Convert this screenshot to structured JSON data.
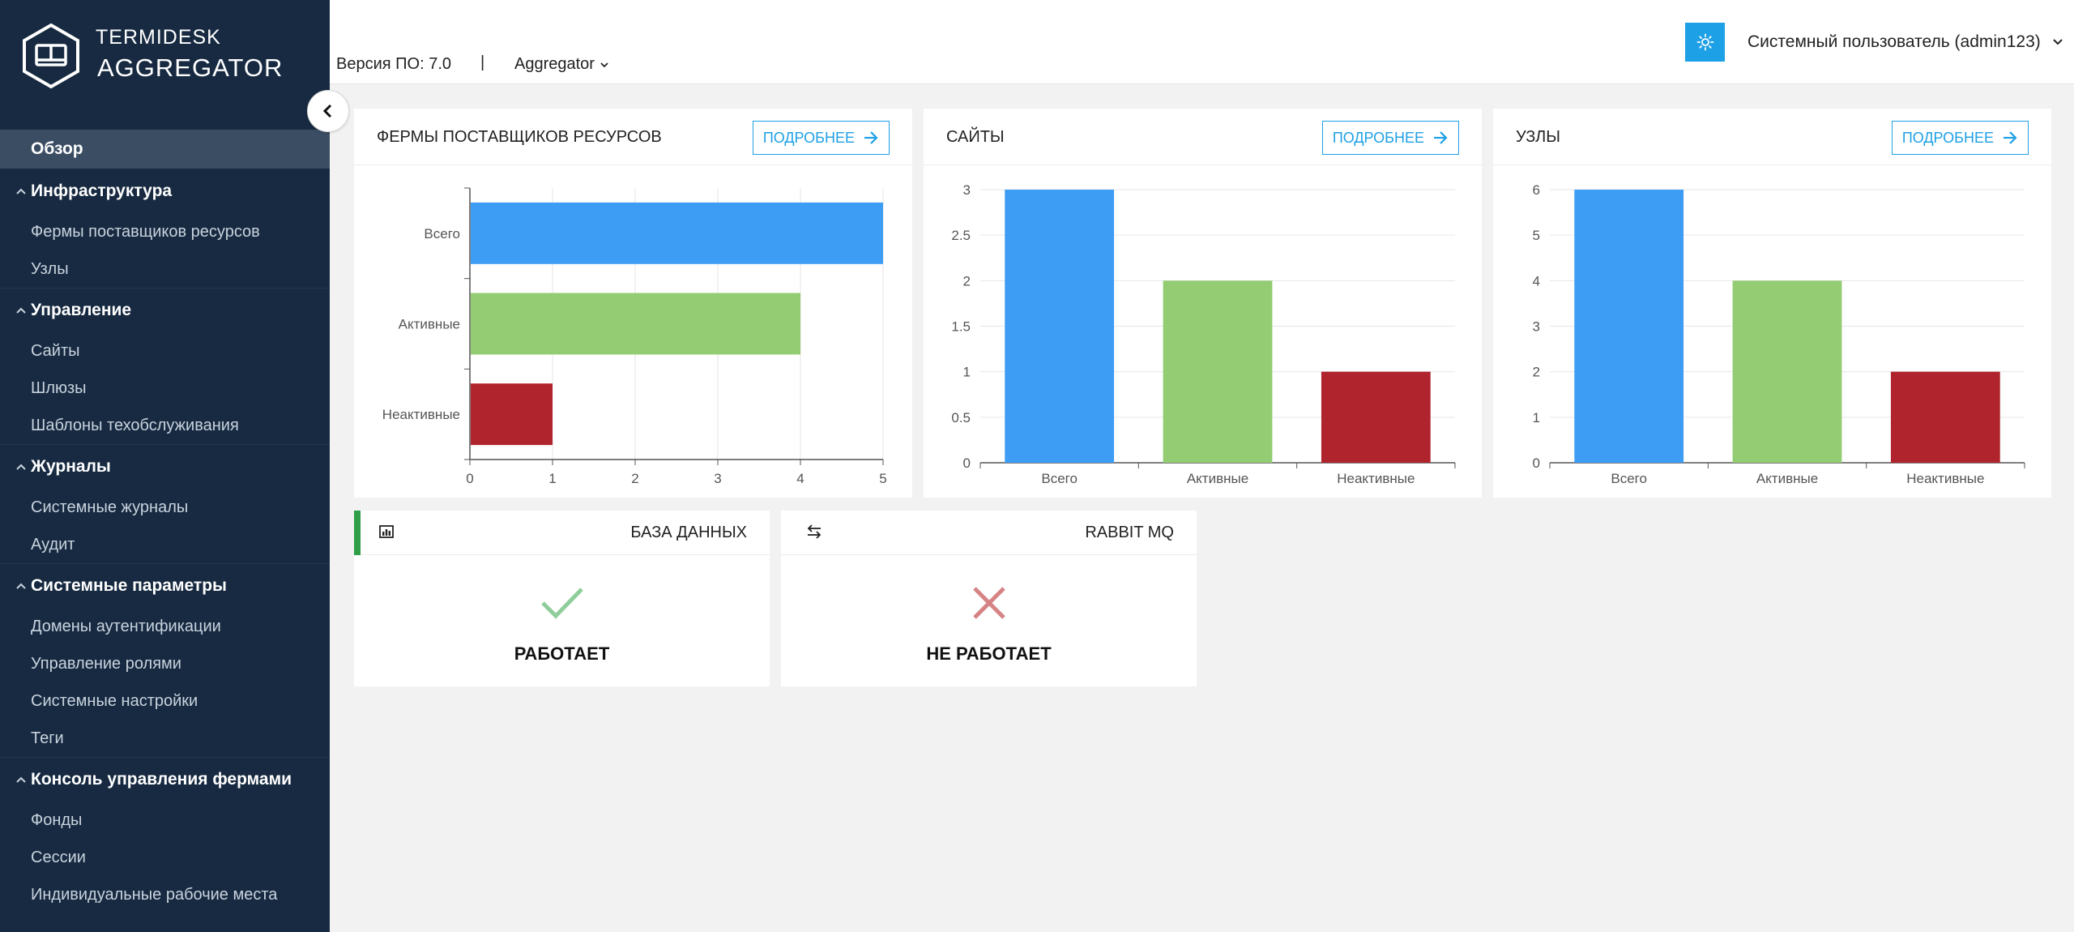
{
  "logo": {
    "top": "TERMIDESK",
    "bottom": "AGGREGATOR"
  },
  "sidebar": {
    "active": "Обзор",
    "groups": [
      {
        "label": "Инфраструктура",
        "items": [
          "Фермы поставщиков ресурсов",
          "Узлы"
        ]
      },
      {
        "label": "Управление",
        "items": [
          "Сайты",
          "Шлюзы",
          "Шаблоны техобслуживания"
        ]
      },
      {
        "label": "Журналы",
        "items": [
          "Системные журналы",
          "Аудит"
        ]
      },
      {
        "label": "Системные параметры",
        "items": [
          "Домены аутентификации",
          "Управление ролями",
          "Системные настройки",
          "Теги"
        ]
      },
      {
        "label": "Консоль управления фермами",
        "items": [
          "Фонды",
          "Сессии",
          "Индивидуальные рабочие места"
        ]
      }
    ]
  },
  "header": {
    "version": "Версия ПО: 7.0",
    "separator": "|",
    "aggregator_menu": "Aggregator",
    "user": "Системный пользователь (admin123)"
  },
  "cards": {
    "farms": {
      "title": "ФЕРМЫ ПОСТАВЩИКОВ РЕСУРСОВ",
      "more": "ПОДРОБНЕЕ"
    },
    "sites": {
      "title": "САЙТЫ",
      "more": "ПОДРОБНЕЕ"
    },
    "nodes": {
      "title": "УЗЛЫ",
      "more": "ПОДРОБНЕЕ"
    }
  },
  "status": {
    "db": {
      "title": "БАЗА ДАННЫХ",
      "state": "РАБОТАЕТ",
      "ok": true
    },
    "rabbit": {
      "title": "RABBIT MQ",
      "state": "НЕ РАБОТАЕТ",
      "ok": false
    }
  },
  "colors": {
    "blue": "#3d9df5",
    "green": "#93cc72",
    "red": "#b0242e",
    "accent": "#1ea0e6",
    "sidebar": "#172a41"
  },
  "chart_data": [
    {
      "type": "bar",
      "orientation": "horizontal",
      "categories": [
        "Всего",
        "Активные",
        "Неактивные"
      ],
      "values": [
        5,
        4,
        1
      ],
      "xlim": [
        0,
        5
      ],
      "ticks": [
        0,
        1,
        2,
        3,
        4,
        5
      ],
      "grid": true
    },
    {
      "type": "bar",
      "categories": [
        "Всего",
        "Активные",
        "Неактивные"
      ],
      "values": [
        3,
        2,
        1
      ],
      "ylim": [
        0,
        3
      ],
      "ticks": [
        0,
        0.5,
        1,
        1.5,
        2,
        2.5,
        3
      ],
      "grid": true
    },
    {
      "type": "bar",
      "categories": [
        "Всего",
        "Активные",
        "Неактивные"
      ],
      "values": [
        6,
        4,
        2
      ],
      "ylim": [
        0,
        6
      ],
      "ticks": [
        0,
        1,
        2,
        3,
        4,
        5,
        6
      ],
      "grid": true
    }
  ]
}
